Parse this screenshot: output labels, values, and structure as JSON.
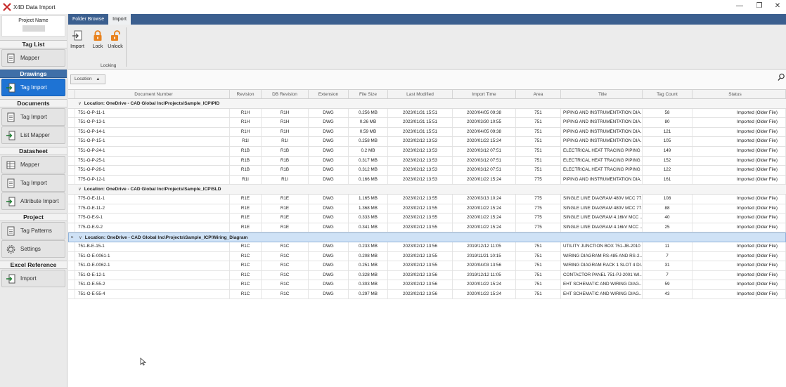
{
  "window": {
    "title": "X4D Data Import",
    "minimize": "—",
    "restore": "❐",
    "close": "✕"
  },
  "sidebar": {
    "project_name_label": "Project Name",
    "sections": [
      {
        "title": "Tag List",
        "active": false,
        "items": [
          {
            "label": "Mapper",
            "icon": "document-icon",
            "active": false
          }
        ]
      },
      {
        "title": "Drawings",
        "active": true,
        "items": [
          {
            "label": "Tag Import",
            "icon": "arrow-import-icon",
            "active": true
          }
        ]
      },
      {
        "title": "Documents",
        "active": false,
        "items": [
          {
            "label": "Tag Import",
            "icon": "document-icon",
            "active": false
          },
          {
            "label": "List Mapper",
            "icon": "arrow-import-icon",
            "active": false
          }
        ]
      },
      {
        "title": "Datasheet",
        "active": false,
        "items": [
          {
            "label": "Mapper",
            "icon": "table-icon",
            "active": false
          },
          {
            "label": "Tag Import",
            "icon": "document-icon",
            "active": false
          },
          {
            "label": "Attribute Import",
            "icon": "arrow-import-icon",
            "active": false
          }
        ]
      },
      {
        "title": "Project",
        "active": false,
        "items": [
          {
            "label": "Tag Patterns",
            "icon": "document-icon",
            "active": false
          },
          {
            "label": "Settings",
            "icon": "gear-icon",
            "active": false
          }
        ]
      },
      {
        "title": "Excel Reference",
        "active": false,
        "items": [
          {
            "label": "Import",
            "icon": "arrow-import-icon",
            "active": false
          }
        ]
      }
    ]
  },
  "ribbon": {
    "tabs": [
      {
        "label": "Folder Browse",
        "active": false
      },
      {
        "label": "Import",
        "active": true
      }
    ],
    "buttons": {
      "import": "Import",
      "lock": "Lock",
      "unlock": "Unlock"
    },
    "group_label": "Locking"
  },
  "grouping": {
    "chip_label": "Location",
    "chip_arrow": "▲"
  },
  "grid": {
    "columns": [
      "Document Number",
      "Revision",
      "DB Revision",
      "Extension",
      "File Size",
      "Last Modified",
      "Import Time",
      "Area",
      "Title",
      "Tag Count",
      "Status"
    ],
    "groups": [
      {
        "label": "Location: OneDrive - CAD Global Inc\\Projects\\Sample_ICP\\PID",
        "selected": false,
        "rows": [
          [
            "751-O-P-11-1",
            "R1H",
            "R1H",
            "DWG",
            "0.256 MB",
            "2023/01/31 15:51",
            "2020/04/05 09:38",
            "751",
            "PIPING AND INSTRUMENTATION DIA...",
            "58",
            "Imported (Older File)"
          ],
          [
            "751-O-P-13-1",
            "R1H",
            "R1H",
            "DWG",
            "0.26 MB",
            "2023/01/31 15:51",
            "2020/03/30 10:55",
            "751",
            "PIPING AND INSTRUMENTATION DIA...",
            "80",
            "Imported (Older File)"
          ],
          [
            "751-O-P-14-1",
            "R1H",
            "R1H",
            "DWG",
            "0.59 MB",
            "2023/01/31 15:51",
            "2020/04/05 09:38",
            "751",
            "PIPING AND INSTRUMENTATION DIA...",
            "121",
            "Imported (Older File)"
          ],
          [
            "751-O-P-15-1",
            "R1I",
            "R1I",
            "DWG",
            "0.258 MB",
            "2023/02/12 13:53",
            "2020/01/22 15:24",
            "751",
            "PIPING AND INSTRUMENTATION DIA...",
            "105",
            "Imported (Older File)"
          ],
          [
            "751-O-P-24-1",
            "R1B",
            "R1B",
            "DWG",
            "0.2 MB",
            "2023/02/12 13:53",
            "2020/03/12 07:51",
            "751",
            "ELECTRICAL HEAT TRACING PIPING ...",
            "149",
            "Imported (Older File)"
          ],
          [
            "751-O-P-25-1",
            "R1B",
            "R1B",
            "DWG",
            "0.317 MB",
            "2023/02/12 13:53",
            "2020/03/12 07:51",
            "751",
            "ELECTRICAL HEAT TRACING PIPING ...",
            "152",
            "Imported (Older File)"
          ],
          [
            "751-O-P-26-1",
            "R1B",
            "R1B",
            "DWG",
            "0.312 MB",
            "2023/02/12 13:53",
            "2020/03/12 07:51",
            "751",
            "ELECTRICAL HEAT TRACING PIPING ...",
            "122",
            "Imported (Older File)"
          ],
          [
            "775-O-P-12-1",
            "R1I",
            "R1I",
            "DWG",
            "0.166 MB",
            "2023/02/12 13:53",
            "2020/01/22 15:24",
            "775",
            "PIPING AND INSTRUMENTATION DIA...",
            "161",
            "Imported (Older File)"
          ]
        ]
      },
      {
        "label": "Location: OneDrive - CAD Global Inc\\Projects\\Sample_ICP\\SLD",
        "selected": false,
        "rows": [
          [
            "775-O-E-11-1",
            "R1E",
            "R1E",
            "DWG",
            "1.165 MB",
            "2023/02/12 13:55",
            "2020/03/13 10:24",
            "775",
            "SINGLE LINE DIAGRAM 480V MCC 77...",
            "108",
            "Imported (Older File)"
          ],
          [
            "775-O-E-11-2",
            "R1E",
            "R1E",
            "DWG",
            "1.368 MB",
            "2023/02/12 13:55",
            "2020/01/22 15:24",
            "775",
            "SINGLE LINE DIAGRAM 480V MCC 77...",
            "88",
            "Imported (Older File)"
          ],
          [
            "775-O-E-9-1",
            "R1E",
            "R1E",
            "DWG",
            "0.333 MB",
            "2023/02/12 13:55",
            "2020/01/22 15:24",
            "775",
            "SINGLE LINE DIAGRAM 4.16kV MCC ...",
            "40",
            "Imported (Older File)"
          ],
          [
            "775-O-E-9-2",
            "R1E",
            "R1E",
            "DWG",
            "0.341 MB",
            "2023/02/12 13:55",
            "2020/01/22 15:24",
            "775",
            "SINGLE LINE DIAGRAM 4.16kV MCC ...",
            "25",
            "Imported (Older File)"
          ]
        ]
      },
      {
        "label": "Location: OneDrive - CAD Global Inc\\Projects\\Sample_ICP\\Wiring_Diagram",
        "selected": true,
        "rows": [
          [
            "751-B-E-15-1",
            "R1C",
            "R1C",
            "DWG",
            "0.233 MB",
            "2023/02/12 13:56",
            "2019/12/12 11:05",
            "751",
            "UTILITY JUNCTION BOX 751-JB-2010 ...",
            "11",
            "Imported (Older File)"
          ],
          [
            "751-O-E-0061-1",
            "R1C",
            "R1C",
            "DWG",
            "0.208 MB",
            "2023/02/12 13:55",
            "2019/11/21 10:15",
            "751",
            "WIRING DIAGRAM RS-485 AND RS-2...",
            "7",
            "Imported (Older File)"
          ],
          [
            "751-O-E-0062-1",
            "R1C",
            "R1C",
            "DWG",
            "0.251 MB",
            "2023/02/12 13:55",
            "2020/04/03 13:56",
            "751",
            "WIRING DIAGRAM RACK 1 SLOT 4 DI...",
            "31",
            "Imported (Older File)"
          ],
          [
            "751-O-E-12-1",
            "R1C",
            "R1C",
            "DWG",
            "0.328 MB",
            "2023/02/12 13:56",
            "2019/12/12 11:05",
            "751",
            "CONTACTOR PANEL 751-PJ-2001 WI...",
            "7",
            "Imported (Older File)"
          ],
          [
            "751-O-E-55-2",
            "R1C",
            "R1C",
            "DWG",
            "0.303 MB",
            "2023/02/12 13:56",
            "2020/01/22 15:24",
            "751",
            "EHT SCHEMATIC AND WIRING DIAG...",
            "59",
            "Imported (Older File)"
          ],
          [
            "751-O-E-55-4",
            "R1C",
            "R1C",
            "DWG",
            "0.297 MB",
            "2023/02/12 13:56",
            "2020/01/22 15:24",
            "751",
            "EHT SCHEMATIC AND WIRING DIAG...",
            "43",
            "Imported (Older File)"
          ]
        ]
      }
    ]
  },
  "colors": {
    "accent": "#3b5f8f",
    "active_nav": "#1e73d4",
    "selected_group": "#cfe2f6",
    "lock_icon": "#e8821e"
  }
}
